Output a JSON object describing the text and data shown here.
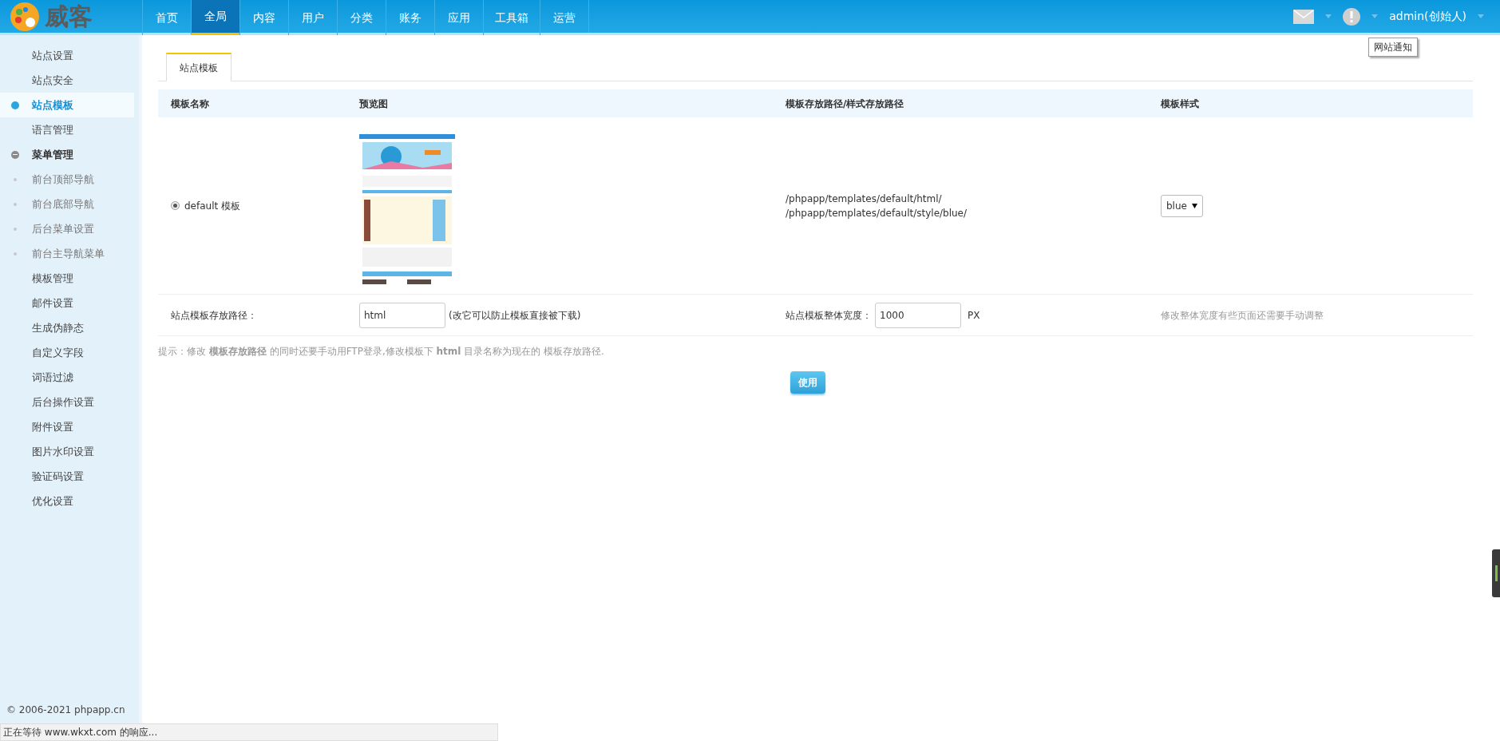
{
  "logo": {
    "text": "威客"
  },
  "nav": [
    {
      "label": "首页",
      "selected": false
    },
    {
      "label": "全局",
      "selected": true
    },
    {
      "label": "内容",
      "selected": false
    },
    {
      "label": "用户",
      "selected": false
    },
    {
      "label": "分类",
      "selected": false
    },
    {
      "label": "账务",
      "selected": false
    },
    {
      "label": "应用",
      "selected": false
    },
    {
      "label": "工具箱",
      "selected": false
    },
    {
      "label": "运营",
      "selected": false
    }
  ],
  "user": {
    "name": "admin(创始人)"
  },
  "tooltip": "网站通知",
  "sidebar": {
    "items": [
      {
        "label": "站点设置",
        "selected": false
      },
      {
        "label": "站点安全",
        "selected": false
      },
      {
        "label": "站点模板",
        "selected": true
      },
      {
        "label": "语言管理",
        "selected": false
      },
      {
        "label": "菜单管理",
        "selected": false,
        "expanded": true,
        "children": [
          {
            "label": "前台顶部导航",
            "selected": false
          },
          {
            "label": "前台底部导航",
            "selected": false
          },
          {
            "label": "后台菜单设置",
            "selected": false
          },
          {
            "label": "前台主导航菜单",
            "selected": false
          }
        ]
      },
      {
        "label": "模板管理",
        "selected": false
      },
      {
        "label": "邮件设置",
        "selected": false
      },
      {
        "label": "生成伪静态",
        "selected": false
      },
      {
        "label": "自定义字段",
        "selected": false
      },
      {
        "label": "词语过滤",
        "selected": false
      },
      {
        "label": "后台操作设置",
        "selected": false
      },
      {
        "label": "附件设置",
        "selected": false
      },
      {
        "label": "图片水印设置",
        "selected": false
      },
      {
        "label": "验证码设置",
        "selected": false
      },
      {
        "label": "优化设置",
        "selected": false
      }
    ],
    "footer": "© 2006-2021 phpapp.cn"
  },
  "tabs": [
    {
      "label": "站点模板",
      "selected": true
    }
  ],
  "table": {
    "columns": [
      "模板名称",
      "预览图",
      "模板存放路径/样式存放路径",
      "模板样式"
    ],
    "rows": [
      {
        "selected": true,
        "name": "default 模板",
        "paths": [
          "/phpapp/templates/default/html/",
          "/phpapp/templates/default/style/blue/"
        ],
        "style": "blue"
      }
    ]
  },
  "settings": {
    "path_label": "站点模板存放路径：",
    "path_value": "html",
    "path_note": "(改它可以防止模板直接被下载)",
    "width_label": "站点模板整体宽度：",
    "width_value": "1000",
    "width_unit": "PX",
    "width_note": "修改整体宽度有些页面还需要手动调整"
  },
  "hint": "提示：修改 **模板存放路径** 的同时还要手动用FTP登录,修改模板下 **html** 目录名称为现在的 模板存放路径.",
  "submit": "使用",
  "status_bar": "正在等待 www.wkxt.com 的响应..."
}
